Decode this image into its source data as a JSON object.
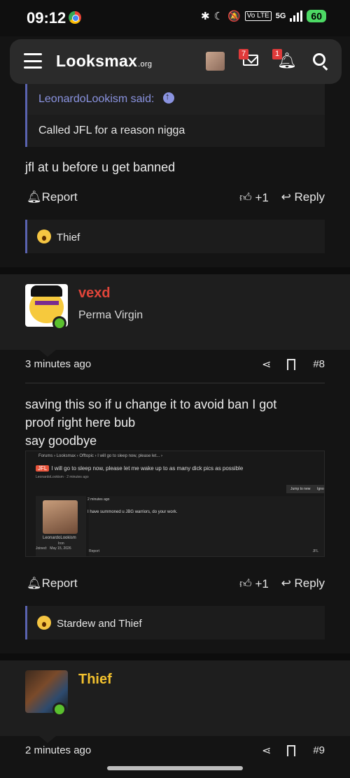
{
  "status_bar": {
    "time": "09:12",
    "network": "5G",
    "volte": "Vo LTE",
    "battery": "60"
  },
  "navbar": {
    "logo_main": "Looksmax",
    "logo_suffix": ".org",
    "mail_count": "7",
    "alerts_count": "1"
  },
  "post1": {
    "quote_author": "LeonardoLookism said:",
    "quote_text": "Called JFL for a reason nigga",
    "text": "jfl at u before u get banned",
    "report_label": "Report",
    "like_label": "+1",
    "reply_label": "Reply",
    "reactions": "Thief"
  },
  "post2": {
    "author": "vexd",
    "author_color": "#e0453a",
    "user_title": "Perma Virgin",
    "time": "3 minutes ago",
    "number": "#8",
    "text_lines": [
      "saving this so if u change it to avoid ban I got",
      "proof right here bub",
      "say goodbye"
    ],
    "embed": {
      "breadcrumbs": "Forums  ›  Looksmax  ›  Offtopic  ›  I will go to sleep now, please let...  ›",
      "tag": "JFL",
      "title": "I will go to sleep now, please let me wake up to as many dick pics as possible",
      "sub": "LeonardoLookism · 2 minutes ago",
      "jump_button": "Jump to new",
      "ignore_button": "Ignore",
      "post_time": "2 minutes ago",
      "post_text": "I have summoned u JBG warriors, do your work.",
      "user": "LeonardoLookism",
      "rank": "Iron",
      "joined_label": "Joined:",
      "joined_value": "May 15, 2026",
      "report": "Report",
      "reaction": "JFL"
    },
    "report_label": "Report",
    "like_label": "+1",
    "reply_label": "Reply",
    "reactions": "Stardew and Thief"
  },
  "post3": {
    "author": "Thief",
    "author_color": "#f2c12e",
    "time": "2 minutes ago",
    "number": "#9"
  }
}
